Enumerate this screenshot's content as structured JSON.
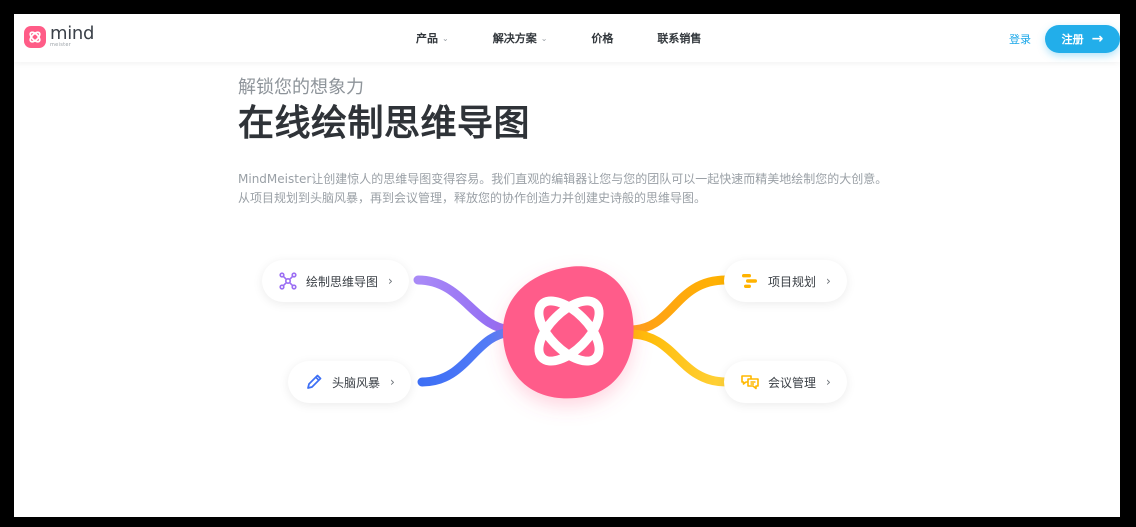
{
  "brand": {
    "name": "mind",
    "sub": "meister"
  },
  "nav": {
    "items": [
      {
        "label": "产品",
        "has_dropdown": true
      },
      {
        "label": "解决方案",
        "has_dropdown": true
      },
      {
        "label": "价格",
        "has_dropdown": false
      },
      {
        "label": "联系销售",
        "has_dropdown": false
      }
    ],
    "login": "登录",
    "signup": "注册",
    "chevron": "⌄",
    "arrow": "→"
  },
  "hero": {
    "kicker": "解锁您的想象力",
    "title": "在线绘制思维导图",
    "description": "MindMeister让创建惊人的思维导图变得容易。我们直观的编辑器让您与您的团队可以一起快速而精美地绘制您的大创意。从项目规划到头脑风暴，再到会议管理，释放您的协作创造力并创建史诗般的思维导图。"
  },
  "mindmap": {
    "chevron": "›",
    "nodes": {
      "draw": {
        "label": "绘制思维导图",
        "icon": "nodes-icon",
        "color": "#9b6ef3"
      },
      "brainstorm": {
        "label": "头脑风暴",
        "icon": "pencil-icon",
        "color": "#3d6ff5"
      },
      "project": {
        "label": "项目规划",
        "icon": "gantt-icon",
        "color": "#ffb300"
      },
      "meeting": {
        "label": "会议管理",
        "icon": "chat-icon",
        "color": "#ffc928"
      }
    },
    "center_color": "#ff5c8a"
  },
  "colors": {
    "accent": "#22aeea",
    "brand": "#ff5c87"
  }
}
